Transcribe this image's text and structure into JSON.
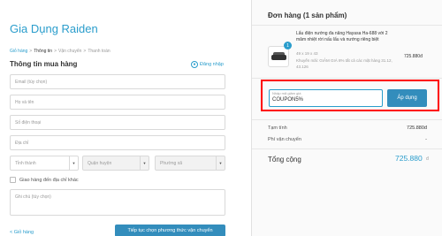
{
  "store": {
    "title": "Gia Dụng Raiden"
  },
  "breadcrumb": {
    "items": [
      "Giỏ hàng",
      "Thông tin",
      "Vận chuyển",
      "Thanh toán"
    ],
    "separator": ">"
  },
  "customer_info": {
    "title": "Thông tin mua hàng",
    "login_label": "Đăng nhập",
    "email_placeholder": "Email (tùy chọn)",
    "name_placeholder": "Họ và tên",
    "phone_placeholder": "Số điện thoại",
    "address_placeholder": "Địa chỉ",
    "province_placeholder": "Tỉnh thành",
    "district_placeholder": "Quận huyện",
    "ward_placeholder": "Phường xã",
    "other_address_label": "Giao hàng đến địa chỉ khác",
    "note_placeholder": "Ghi chú (tùy chọn)"
  },
  "footer": {
    "back_label": "< Giỏ hàng",
    "continue_label": "Tiếp tục chọn phương thức vận chuyển"
  },
  "order": {
    "title": "Đơn hàng (1 sản phẩm)",
    "product": {
      "quantity": "1",
      "name": "Lẩu điện nướng đa năng Hayasa Ha-688 với 2 mâm nhiệt rời nấu lẩu và nướng riêng biệt",
      "variant": "49 x 19 x 43",
      "promo": "Khuyến mãi: GIẢM GIÁ 8% tất cả các mặt hàng 31.12, 43.126",
      "price": "725.880đ"
    },
    "discount": {
      "label": "Nhập mã giảm giá",
      "value": "COUPON5%",
      "apply_label": "Áp dụng"
    },
    "subtotal_label": "Tạm tính",
    "subtotal_value": "725.880đ",
    "shipping_label": "Phí vận chuyển",
    "shipping_value": "-",
    "total_label": "Tổng cộng",
    "total_value": "725.880",
    "total_currency": "đ"
  },
  "colors": {
    "accent": "#2a9dcc",
    "button": "#338dbc",
    "highlight_border": "#ff0000"
  },
  "icons": [
    "user-icon",
    "chevron-down-icon",
    "checkbox-icon"
  ]
}
